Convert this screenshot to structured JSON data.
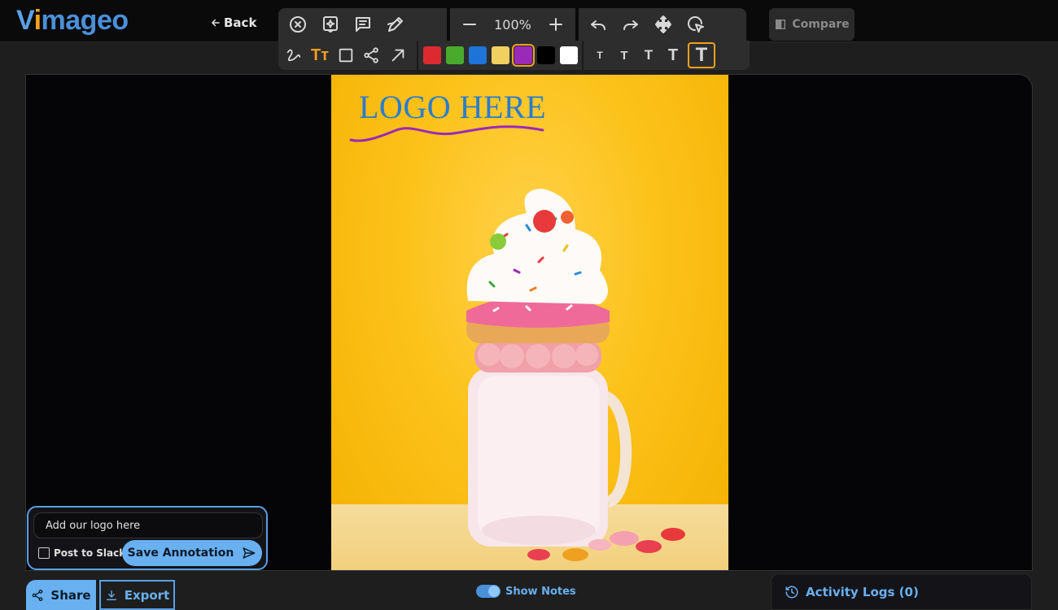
{
  "header": {
    "logo_text": "Vimageo",
    "back_label": "Back",
    "compare_label": "Compare"
  },
  "toolbar": {
    "zoom_level": "100%",
    "tools_row1": [
      "close-circle-icon",
      "ai-sparkle-icon",
      "comment-icon",
      "pen-edit-icon",
      "zoom-out-icon",
      "zoom-in-icon",
      "undo-icon",
      "redo-icon",
      "move-icon",
      "select-pointer-icon"
    ],
    "tools_row2": [
      "freehand-icon",
      "text-tool-icon",
      "rectangle-icon",
      "connector-icon",
      "arrow-icon"
    ],
    "active_tool": "text-tool-icon",
    "colors": [
      "#dd2a30",
      "#4aaa2e",
      "#1e74d8",
      "#f2d060",
      "#9a2ab8",
      "#000000",
      "#ffffff"
    ],
    "selected_color": "#9a2ab8",
    "text_size_glyph": "T",
    "text_sizes_count": 5,
    "active_text_size": 5
  },
  "canvas": {
    "image_logo_text": "LOGO HERE",
    "annotation_color": "#9a2ab8",
    "background_color": "#fcc21a"
  },
  "annotation": {
    "input_value": "Add our logo here",
    "post_to_slack_label": "Post to Slack",
    "post_to_slack_checked": false,
    "save_label": "Save Annotation"
  },
  "footer": {
    "share_label": "Share",
    "export_label": "Export",
    "show_notes_label": "Show Notes",
    "show_notes_on": true,
    "activity_logs_label": "Activity Logs (0)"
  }
}
